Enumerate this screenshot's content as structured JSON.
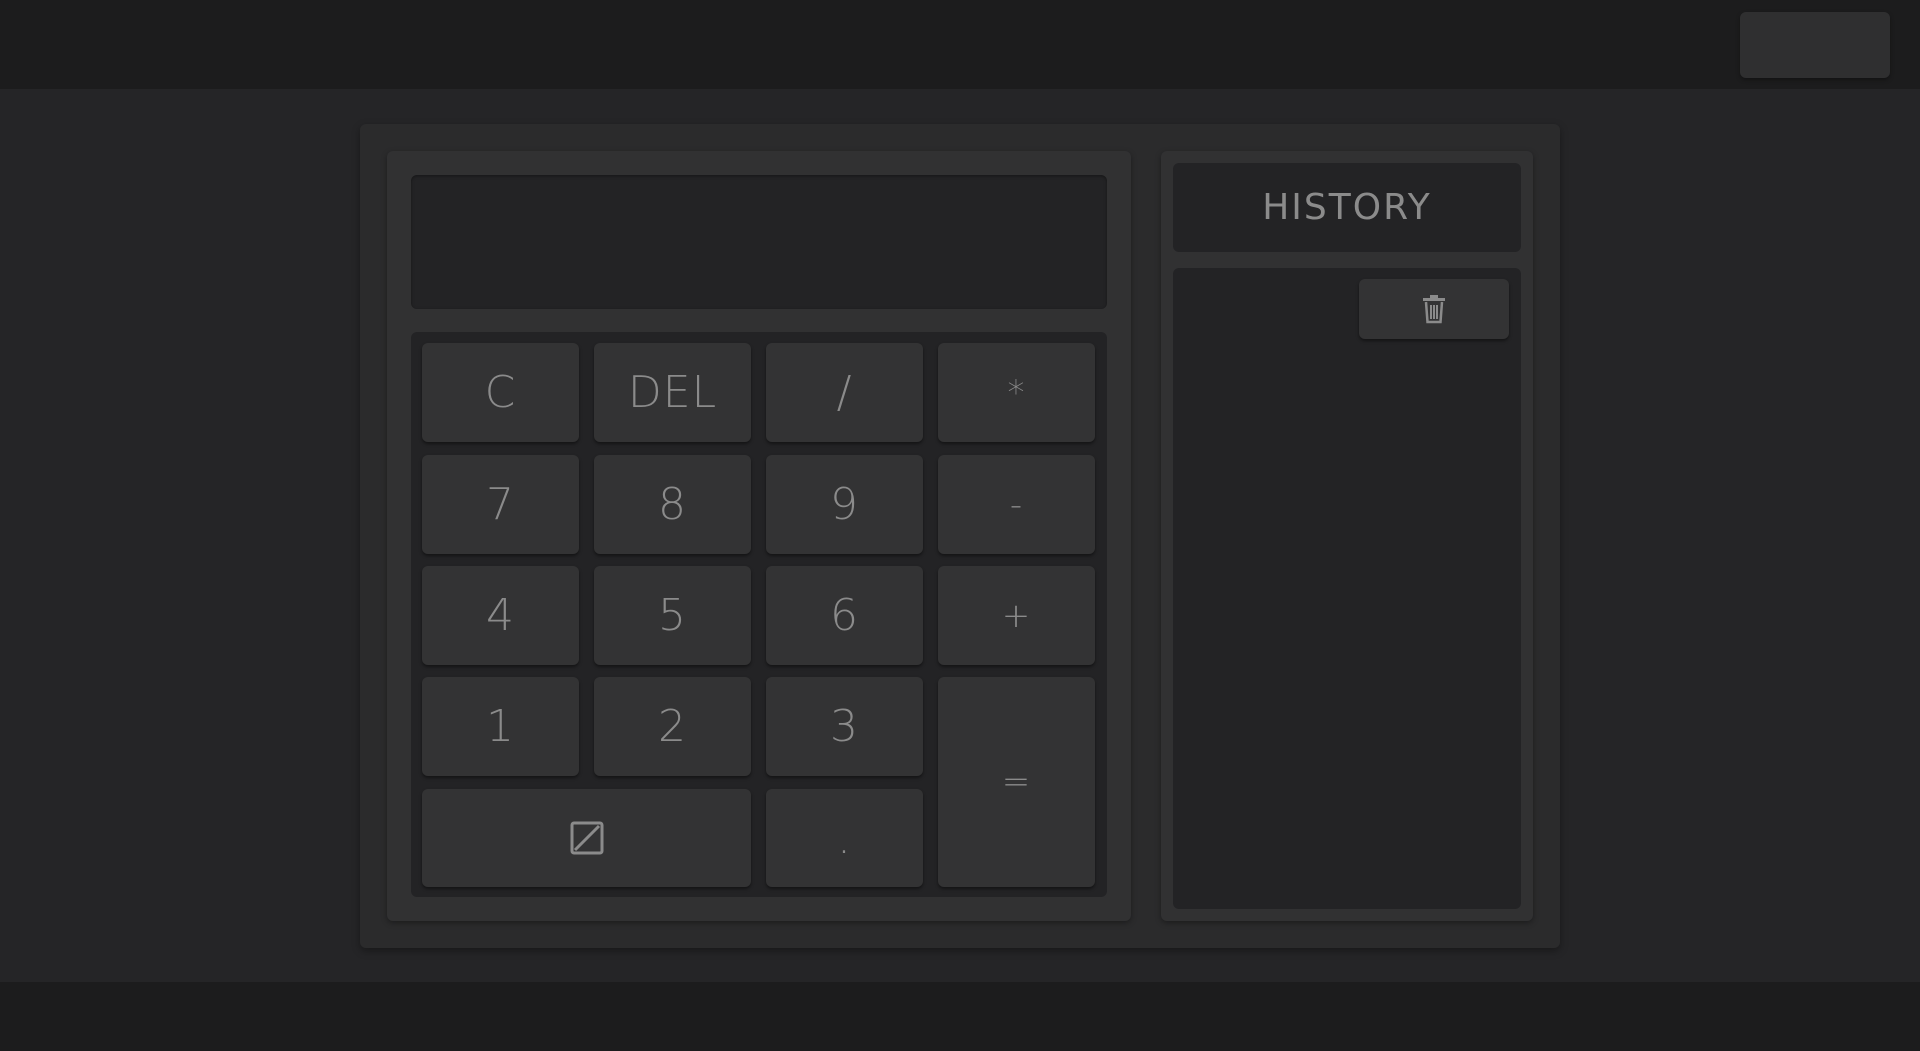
{
  "display": {
    "value": ""
  },
  "keypad": {
    "clear": "C",
    "delete": "DEL",
    "divide": "/",
    "multiply": "*",
    "seven": "7",
    "eight": "8",
    "nine": "9",
    "minus": "-",
    "four": "4",
    "five": "5",
    "six": "6",
    "plus": "+",
    "one": "1",
    "two": "2",
    "three": "3",
    "equals": "=",
    "decimal": "."
  },
  "history": {
    "title": "HISTORY",
    "entries": [],
    "clear_icon": "trash-icon"
  },
  "icons": {
    "zero_key_icon": "empty-set-icon"
  },
  "colors": {
    "background": "#252527",
    "bars": "#1c1c1d",
    "panel": "#313132",
    "inset": "#232325",
    "key": "#333334",
    "text": "#8b8b8b"
  }
}
